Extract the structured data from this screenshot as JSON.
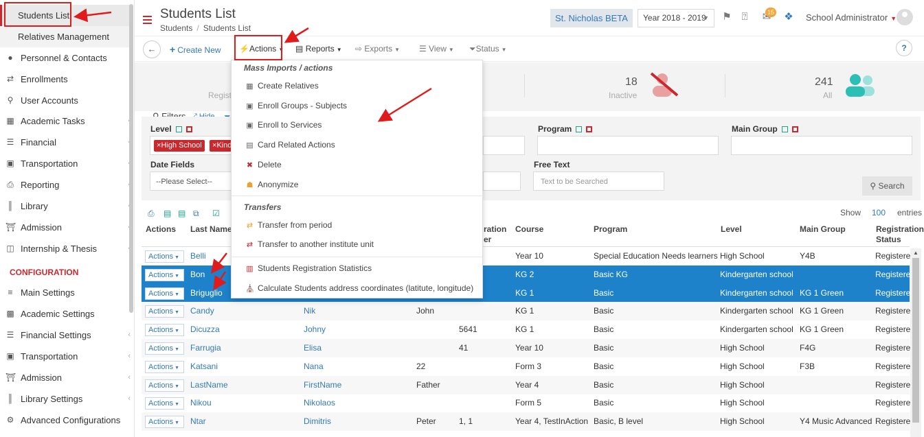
{
  "sidebar": {
    "sub_items": [
      {
        "label": "Students List",
        "active": true
      },
      {
        "label": "Relatives Management",
        "active": false
      }
    ],
    "items": [
      {
        "label": "Personnel & Contacts",
        "icon": "person-icon",
        "chevron": false
      },
      {
        "label": "Enrollments",
        "icon": "arrows-icon",
        "chevron": false
      },
      {
        "label": "User Accounts",
        "icon": "key-icon",
        "chevron": false
      },
      {
        "label": "Academic Tasks",
        "icon": "grid-icon",
        "chevron": true
      },
      {
        "label": "Financial",
        "icon": "coins-icon",
        "chevron": true
      },
      {
        "label": "Transportation",
        "icon": "bus-icon",
        "chevron": true
      },
      {
        "label": "Reporting",
        "icon": "printer-icon",
        "chevron": true
      },
      {
        "label": "Library",
        "icon": "books-icon",
        "chevron": true
      },
      {
        "label": "Admission",
        "icon": "building-icon",
        "chevron": true
      },
      {
        "label": "Internship & Thesis",
        "icon": "cube-icon",
        "chevron": true
      }
    ],
    "config_heading": "CONFIGURATION",
    "config_items": [
      {
        "label": "Main Settings",
        "icon": "sliders-icon",
        "chevron": false
      },
      {
        "label": "Academic Settings",
        "icon": "people-icon",
        "chevron": false
      },
      {
        "label": "Financial Settings",
        "icon": "coins-icon",
        "chevron": true
      },
      {
        "label": "Transportation",
        "icon": "bus-icon",
        "chevron": true
      },
      {
        "label": "Admission",
        "icon": "building-icon",
        "chevron": true
      },
      {
        "label": "Library Settings",
        "icon": "books-icon",
        "chevron": true
      },
      {
        "label": "Advanced Configurations",
        "icon": "gears-icon",
        "chevron": false
      }
    ]
  },
  "header": {
    "title": "Students List",
    "breadcrumb": [
      "Students",
      "Students List"
    ],
    "school": "St. Nicholas BETA",
    "year": "Year 2018 - 2019",
    "mail_badge": "15",
    "user": "School Administrator"
  },
  "toolbar": {
    "create": "Create New",
    "actions": "Actions",
    "reports": "Reports",
    "exports": "Exports",
    "view": "View",
    "status": "Status",
    "help": "?"
  },
  "stats": {
    "registered_label": "Regist",
    "inactive_count": "18",
    "inactive_label": "Inactive",
    "all_count": "241",
    "all_label": "All"
  },
  "filters": {
    "title": "Filters",
    "hide": "Hide",
    "level_label": "Level",
    "level_tags": [
      "High School",
      "Kind"
    ],
    "program_label": "Program",
    "main_group_label": "Main Group",
    "date_fields_label": "Date Fields",
    "date_fields_value": "--Please Select--",
    "free_text_label": "Free Text",
    "free_text_placeholder": "Text to be Searched",
    "search_button": "Search"
  },
  "table": {
    "show_label": "Show",
    "page_size": "100",
    "entries_label": "entries",
    "headers": {
      "actions": "Actions",
      "last_name": "Last Name",
      "registration_a": "ration",
      "registration_b": "er",
      "course": "Course",
      "program": "Program",
      "level": "Level",
      "main_group": "Main Group",
      "reg_status_a": "Registration",
      "reg_status_b": "Status"
    },
    "action_label": "Actions",
    "rows": [
      {
        "last": "Belli",
        "first": "",
        "father": "",
        "reg": "",
        "course": "Year 10",
        "program": "Special Education Needs learners",
        "level": "High School",
        "group": "Y4B",
        "status": "Registere",
        "selected": false
      },
      {
        "last": "Bon",
        "first": "",
        "father": "",
        "reg": "",
        "course": "KG 2",
        "program": "Basic KG",
        "level": "Kindergarten school",
        "group": "",
        "status": "Registere",
        "selected": true
      },
      {
        "last": "Briguglio",
        "first": "",
        "father": "",
        "reg": "",
        "course": "KG 1",
        "program": "Basic",
        "level": "Kindergarten school",
        "group": "KG 1 Green",
        "status": "Registere",
        "selected": true
      },
      {
        "last": "Candy",
        "first": "Nik",
        "father": "John",
        "reg": "",
        "course": "KG 1",
        "program": "Basic",
        "level": "Kindergarten school",
        "group": "KG 1 Green",
        "status": "Registere",
        "selected": false
      },
      {
        "last": "Dicuzza",
        "first": "Johny",
        "father": "",
        "reg": "5641",
        "course": "KG 1",
        "program": "Basic",
        "level": "Kindergarten school",
        "group": "KG 1 Green",
        "status": "Registere",
        "selected": false
      },
      {
        "last": "Farrugia",
        "first": "Elisa",
        "father": "",
        "reg": "41",
        "course": "Year 10",
        "program": "Basic",
        "level": "High School",
        "group": "F4G",
        "status": "Registere",
        "selected": false
      },
      {
        "last": "Katsani",
        "first": "Nana",
        "father": "22",
        "reg": "",
        "course": "Form 3",
        "program": "Basic",
        "level": "High School",
        "group": "F3B",
        "status": "Registere",
        "selected": false
      },
      {
        "last": "LastName",
        "first": "FirstName",
        "father": "Father",
        "reg": "",
        "course": "Year 4",
        "program": "Basic",
        "level": "High School",
        "group": "",
        "status": "Registere",
        "selected": false
      },
      {
        "last": "Nikou",
        "first": "Nikolaos",
        "father": "",
        "reg": "",
        "course": "Form 5",
        "program": "Basic",
        "level": "High School",
        "group": "",
        "status": "Registere",
        "selected": false
      },
      {
        "last": "Ntar",
        "first": "Dimitris",
        "father": "Peter",
        "reg": "1, 1",
        "course": "Year 4, TestInAction",
        "program": "Basic, B level",
        "level": "High School",
        "group": "Y4 Music Advanced",
        "status": "Registere",
        "selected": false
      }
    ]
  },
  "menu": {
    "heading1": "Mass Imports / actions",
    "group1": [
      {
        "label": "Create Relatives",
        "icon": "table-icon",
        "color": "#666666"
      },
      {
        "label": "Enroll Groups - Subjects",
        "icon": "enroll-icon",
        "color": "#666666"
      },
      {
        "label": "Enroll to Services",
        "icon": "enroll-icon",
        "color": "#666666"
      },
      {
        "label": "Card Related Actions",
        "icon": "card-icon",
        "color": "#666666"
      },
      {
        "label": "Delete",
        "icon": "trash-icon",
        "color": "#c9282d"
      },
      {
        "label": "Anonymize",
        "icon": "mask-icon",
        "color": "#f0a030"
      }
    ],
    "heading2": "Transfers",
    "group2": [
      {
        "label": "Transfer from period",
        "icon": "transfer-icon",
        "color": "#f0a030"
      },
      {
        "label": "Transfer to another institute unit",
        "icon": "transfer-icon",
        "color": "#c9282d"
      }
    ],
    "group3": [
      {
        "label": "Students Registration Statistics",
        "icon": "stats-icon",
        "color": "#c9282d"
      },
      {
        "label": "Calculate Students address coordinates (latitute, longitude)",
        "icon": "building-icon",
        "color": "#666666"
      }
    ]
  },
  "colors": {
    "accent": "#c9282d",
    "link": "#337ab7",
    "selected_row": "#1d82c9",
    "annotation": "#e01b1b"
  }
}
